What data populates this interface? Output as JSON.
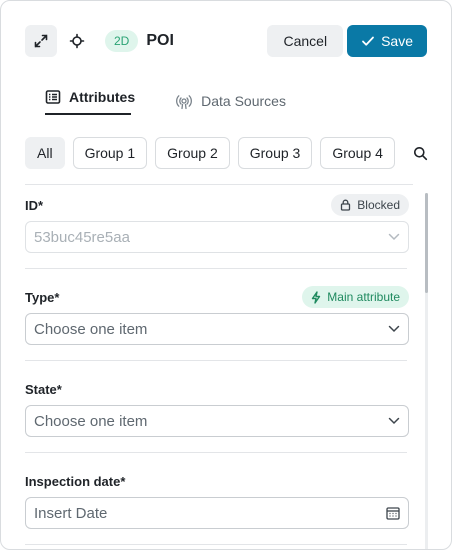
{
  "header": {
    "badge": "2D",
    "title": "POI",
    "cancel_label": "Cancel",
    "save_label": "Save",
    "save_color": "#0a79a6"
  },
  "tabs": [
    {
      "label": "Attributes",
      "icon": "list-icon",
      "active": true
    },
    {
      "label": "Data Sources",
      "icon": "broadcast-icon",
      "active": false
    }
  ],
  "groups": [
    "All",
    "Group 1",
    "Group 2",
    "Group 3",
    "Group 4"
  ],
  "fields": {
    "id": {
      "label": "ID*",
      "value": "53buc45re5aa",
      "badge": "Blocked"
    },
    "type": {
      "label": "Type*",
      "placeholder": "Choose one item",
      "badge": "Main attribute"
    },
    "state": {
      "label": "State*",
      "placeholder": "Choose one item"
    },
    "inspection_date": {
      "label": "Inspection date*",
      "placeholder": "Insert Date"
    }
  }
}
